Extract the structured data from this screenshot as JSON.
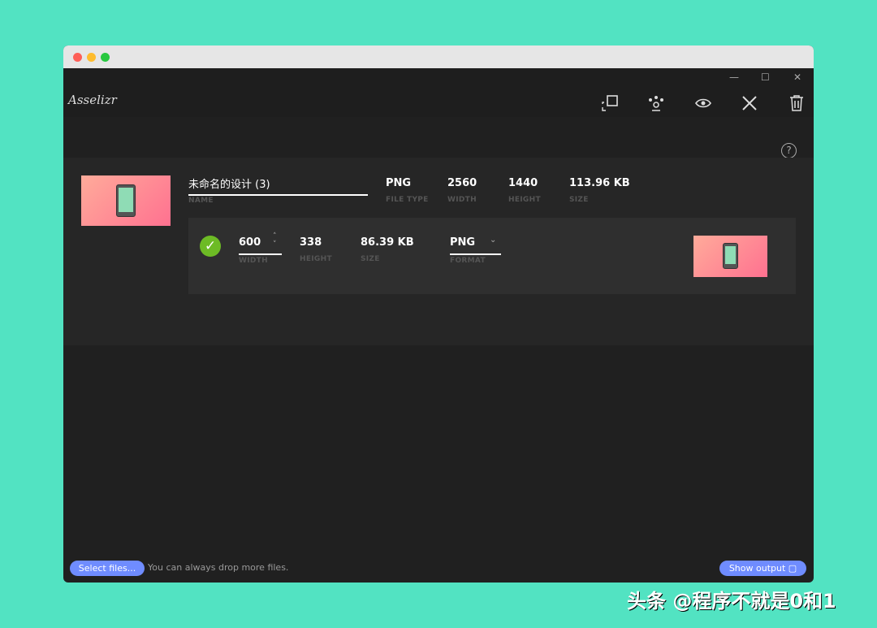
{
  "window": {
    "app_name": "Asselizr",
    "controls": {
      "minimize": "—",
      "maximize": "☐",
      "close": "✕"
    }
  },
  "toolbar": {
    "icons": [
      "resize-icon",
      "people-icon",
      "eye-icon",
      "tools-icon",
      "trash-icon"
    ],
    "help": "?"
  },
  "source": {
    "name": "未命名的设计 (3)",
    "name_label": "NAME",
    "file_type": "PNG",
    "file_type_label": "FILE TYPE",
    "width": "2560",
    "width_label": "WIDTH",
    "height": "1440",
    "height_label": "HEIGHT",
    "size": "113.96 KB",
    "size_label": "SIZE"
  },
  "output": {
    "width": "600",
    "width_label": "WIDTH",
    "height": "338",
    "height_label": "HEIGHT",
    "size": "86.39 KB",
    "size_label": "SIZE",
    "format": "PNG",
    "format_label": "FORMAT"
  },
  "footer": {
    "select_files": "Select files...",
    "hint": "You can always drop more files.",
    "show_output": "Show output"
  },
  "watermark": "头条 @程序不就是0和1",
  "colors": {
    "accent": "#6f8cff",
    "success": "#6dbb25",
    "background": "#52e3c2"
  }
}
